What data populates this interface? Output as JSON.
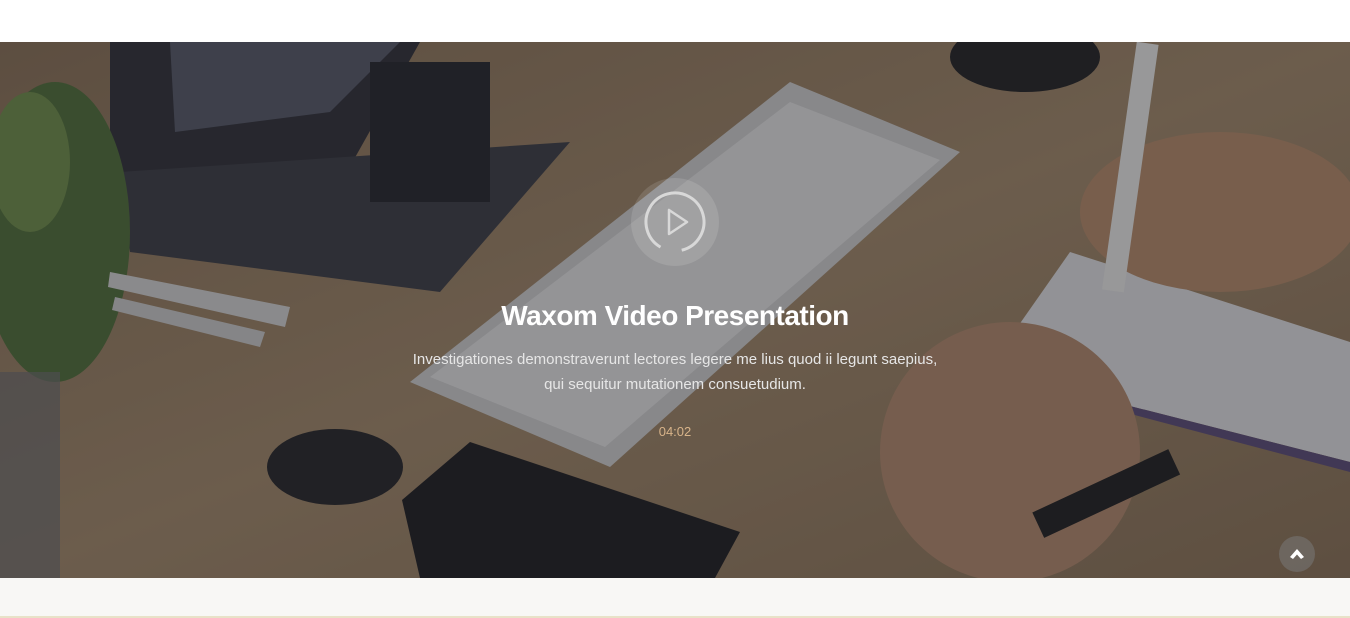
{
  "hero": {
    "title": "Waxom Video Presentation",
    "description": "Investigationes demonstraverunt lectores legere me lius quod ii legunt saepius, qui sequitur mutationem consuetudium.",
    "duration": "04:02",
    "play_icon": "play-circle-icon",
    "overlay_color": "#1e1e22"
  },
  "scroll_top": {
    "icon": "chevron-up-icon"
  },
  "colors": {
    "duration_accent": "#d8b48a",
    "title": "#ffffff"
  }
}
